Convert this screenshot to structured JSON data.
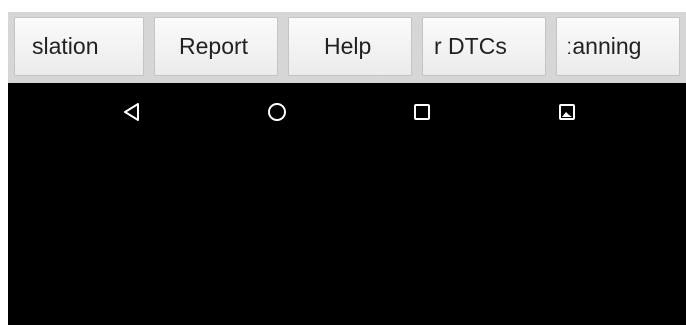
{
  "toolbar": {
    "buttons": [
      {
        "label": "slation"
      },
      {
        "label": "Report"
      },
      {
        "label": "Help"
      },
      {
        "label": "r DTCs"
      },
      {
        "label": "ːanning"
      }
    ]
  },
  "navbar": {
    "icons": [
      "back-icon",
      "home-icon",
      "recents-icon",
      "screenshot-icon"
    ]
  },
  "colors": {
    "toolbar_bg": "#d6d6d6",
    "button_bg": "#f5f5f5",
    "button_text": "#222222",
    "screen_bg": "#000000",
    "nav_icon": "#ffffff"
  }
}
